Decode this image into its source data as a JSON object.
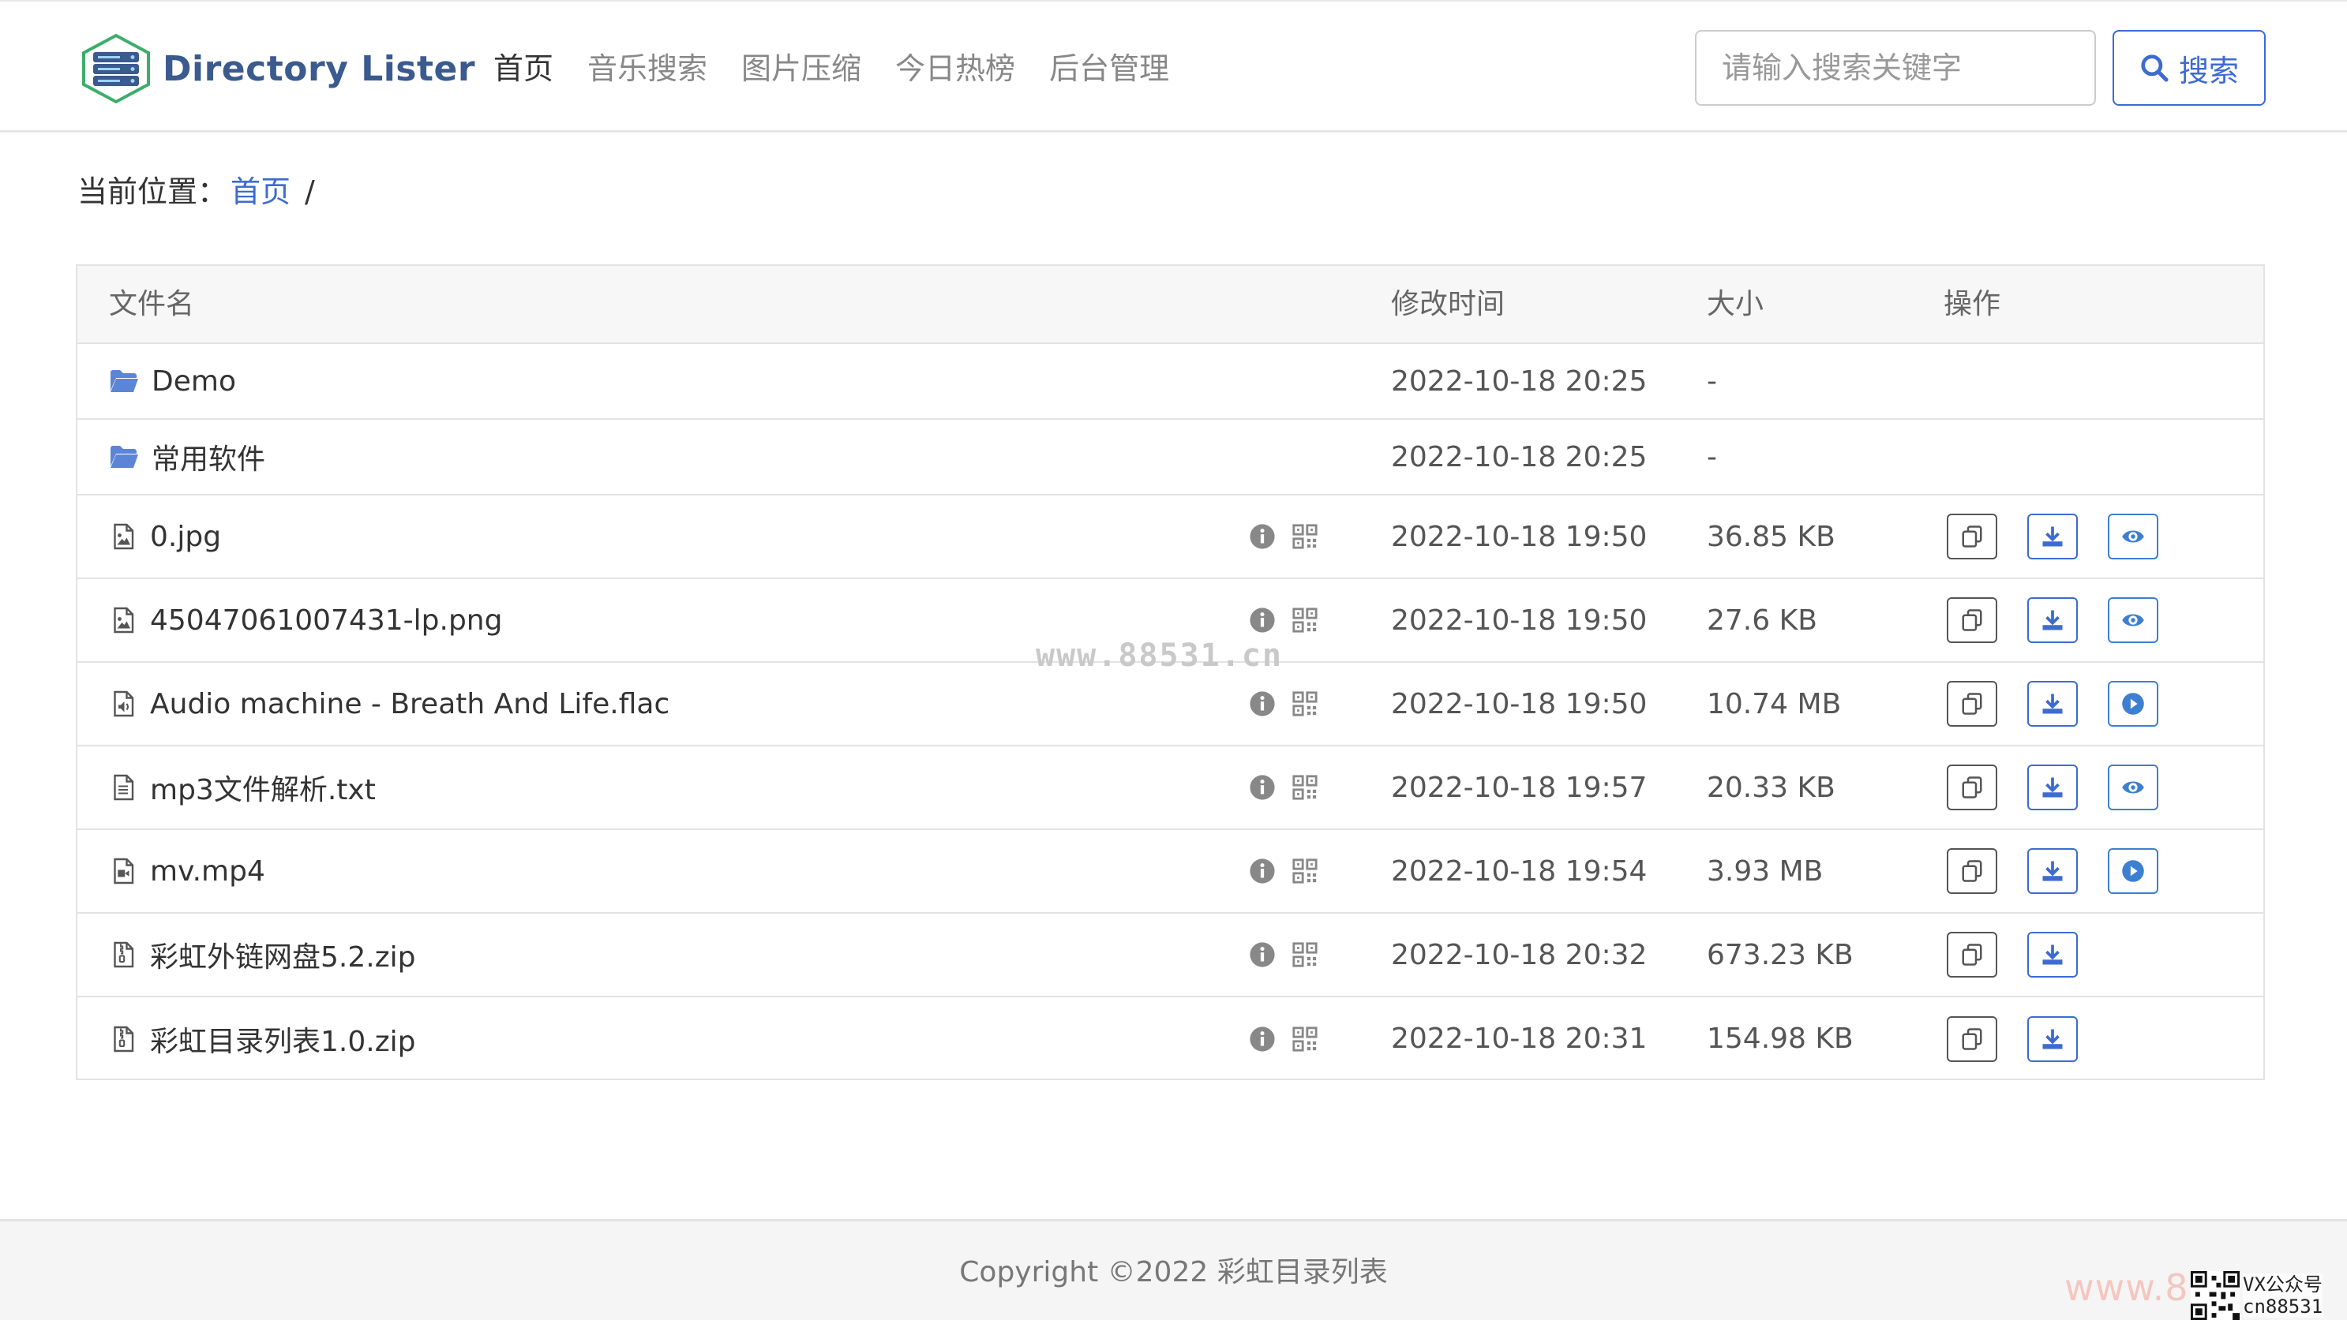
{
  "brand": {
    "name": "Directory Lister"
  },
  "nav": {
    "items": [
      {
        "label": "首页",
        "active": true
      },
      {
        "label": "音乐搜索",
        "active": false
      },
      {
        "label": "图片压缩",
        "active": false
      },
      {
        "label": "今日热榜",
        "active": false
      },
      {
        "label": "后台管理",
        "active": false
      }
    ]
  },
  "search": {
    "placeholder": "请输入搜索关键字",
    "button_label": "搜索"
  },
  "breadcrumb": {
    "prefix": "当前位置：",
    "home": "首页",
    "separator": "/"
  },
  "table": {
    "headers": {
      "name": "文件名",
      "time": "修改时间",
      "size": "大小",
      "ops": "操作"
    },
    "rows": [
      {
        "name": "Demo",
        "time": "2022-10-18 20:25",
        "size": "-",
        "kind": "folder"
      },
      {
        "name": "常用软件",
        "time": "2022-10-18 20:25",
        "size": "-",
        "kind": "folder"
      },
      {
        "name": "0.jpg",
        "time": "2022-10-18 19:50",
        "size": "36.85 KB",
        "kind": "image",
        "action": "preview"
      },
      {
        "name": "45047061007431-lp.png",
        "time": "2022-10-18 19:50",
        "size": "27.6 KB",
        "kind": "image",
        "action": "preview"
      },
      {
        "name": "Audio machine - Breath And Life.flac",
        "time": "2022-10-18 19:50",
        "size": "10.74 MB",
        "kind": "audio",
        "action": "play"
      },
      {
        "name": "mp3文件解析.txt",
        "time": "2022-10-18 19:57",
        "size": "20.33 KB",
        "kind": "text",
        "action": "preview"
      },
      {
        "name": "mv.mp4",
        "time": "2022-10-18 19:54",
        "size": "3.93 MB",
        "kind": "video",
        "action": "play"
      },
      {
        "name": "彩虹外链网盘5.2.zip",
        "time": "2022-10-18 20:32",
        "size": "673.23 KB",
        "kind": "archive",
        "action": "none"
      },
      {
        "name": "彩虹目录列表1.0.zip",
        "time": "2022-10-18 20:31",
        "size": "154.98 KB",
        "kind": "archive",
        "action": "none"
      }
    ]
  },
  "watermark": {
    "text": "www.88531.cn"
  },
  "footer": {
    "copyright": "Copyright ©2022 彩虹目录列表"
  },
  "corner": {
    "mark": "www.8",
    "badge_line1": "VX公众号",
    "badge_line2": "cn88531"
  },
  "colors": {
    "accent": "#3d6bd1",
    "brand": "#3b5a8e",
    "border": "#e3e3e3",
    "header_bg": "#f7f7f7"
  }
}
